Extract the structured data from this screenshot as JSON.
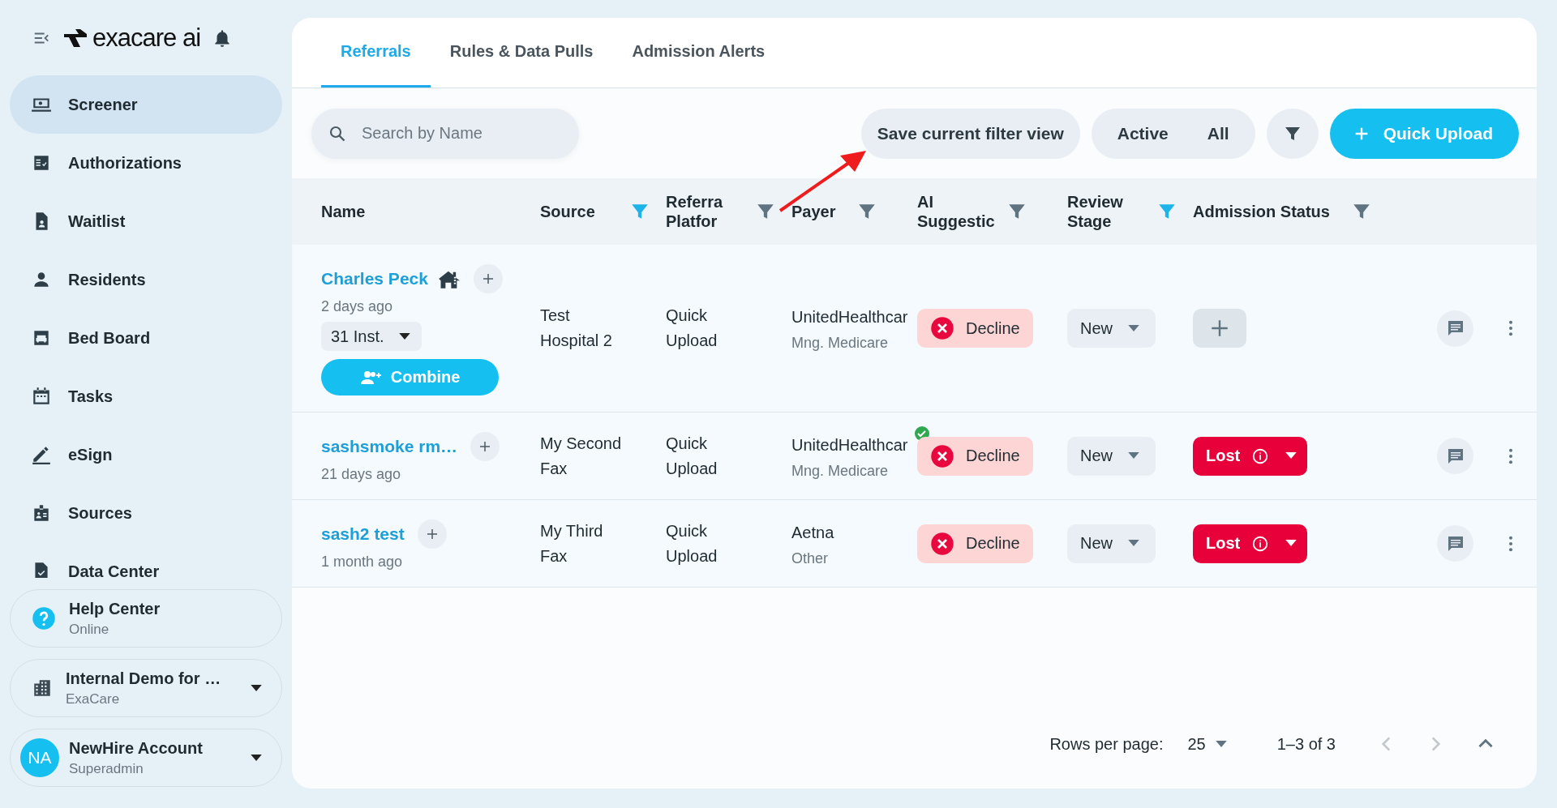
{
  "sidebar": {
    "logo": "exacare ai",
    "nav": [
      {
        "label": "Screener",
        "selected": true
      },
      {
        "label": "Authorizations",
        "selected": false
      },
      {
        "label": "Waitlist",
        "selected": false
      },
      {
        "label": "Residents",
        "selected": false
      },
      {
        "label": "Bed Board",
        "selected": false
      },
      {
        "label": "Tasks",
        "selected": false
      },
      {
        "label": "eSign",
        "selected": false
      },
      {
        "label": "Sources",
        "selected": false
      },
      {
        "label": "Data Center",
        "selected": false
      }
    ],
    "help": {
      "title": "Help Center",
      "status": "Online"
    },
    "org": {
      "name": "Internal Demo for …",
      "sub": "ExaCare"
    },
    "account": {
      "initials": "NA",
      "name": "NewHire Account",
      "role": "Superadmin"
    }
  },
  "tabs": [
    {
      "label": "Referrals",
      "selected": true
    },
    {
      "label": "Rules & Data Pulls",
      "selected": false
    },
    {
      "label": "Admission Alerts",
      "selected": false
    }
  ],
  "toolbar": {
    "search_placeholder": "Search by Name",
    "save_filter": "Save current filter view",
    "scope": [
      "Active",
      "All"
    ],
    "quick_upload": "Quick Upload"
  },
  "table": {
    "columns": [
      {
        "label": "Name"
      },
      {
        "label": "Source",
        "filtered": true
      },
      {
        "label": "Referra Platfor",
        "filtered": false
      },
      {
        "label": "Payer",
        "filtered": false
      },
      {
        "label": "AI Suggestic",
        "filtered": false
      },
      {
        "label": "Review Stage",
        "filtered": true
      },
      {
        "label": "Admission Status",
        "filtered": false
      }
    ],
    "rows": [
      {
        "name": "Charles Peck",
        "age": "2 days ago",
        "facility_icon": true,
        "instances": "31 Inst.",
        "combine": "Combine",
        "source": "Test Hospital 2",
        "platform": "Quick Upload",
        "payer": "UnitedHealthcar",
        "payer_type": "Mng. Medicare",
        "payer_verified": false,
        "ai": "Decline",
        "stage": "New",
        "admission": {
          "kind": "add"
        }
      },
      {
        "name": "sashsmoke rm…",
        "age": "21 days ago",
        "facility_icon": false,
        "source": "My Second Fax",
        "platform": "Quick Upload",
        "payer": "UnitedHealthcar",
        "payer_type": "Mng. Medicare",
        "payer_verified": true,
        "ai": "Decline",
        "stage": "New",
        "admission": {
          "kind": "status",
          "label": "Lost"
        }
      },
      {
        "name": "sash2 test",
        "age": "1 month ago",
        "facility_icon": false,
        "source": "My Third Fax",
        "platform": "Quick Upload",
        "payer": "Aetna",
        "payer_type": "Other",
        "payer_verified": false,
        "ai": "Decline",
        "stage": "New",
        "admission": {
          "kind": "status",
          "label": "Lost"
        }
      }
    ]
  },
  "pagination": {
    "rows_per_page_label": "Rows per page:",
    "rows_per_page": "25",
    "range": "1–3 of 3"
  }
}
